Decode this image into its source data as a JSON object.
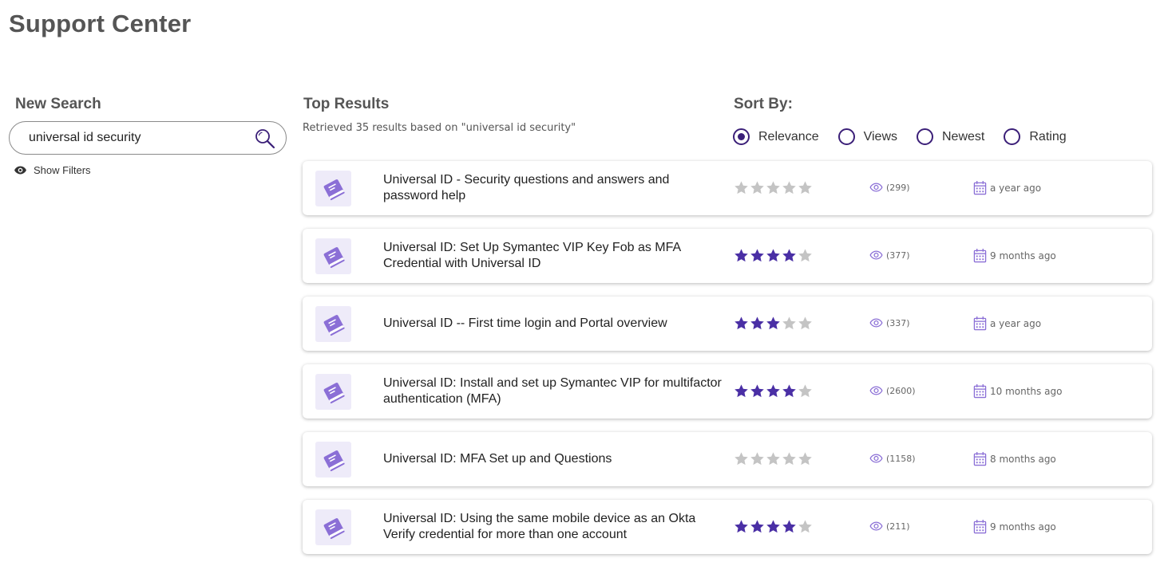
{
  "page": {
    "title": "Support Center"
  },
  "search": {
    "heading": "New Search",
    "value": "universal id security",
    "placeholder": "",
    "show_filters_label": "Show Filters"
  },
  "results": {
    "heading": "Top Results",
    "summary": "Retrieved 35 results based on \"universal id security\""
  },
  "sort": {
    "heading": "Sort By:",
    "options": [
      {
        "label": "Relevance",
        "selected": true
      },
      {
        "label": "Views",
        "selected": false
      },
      {
        "label": "Newest",
        "selected": false
      },
      {
        "label": "Rating",
        "selected": false
      }
    ]
  },
  "colors": {
    "accent": "#3b1f78",
    "star_filled": "#4a2fa5",
    "star_empty": "#c4c4c4",
    "icon_purple": "#8b6fd6",
    "tile_bg": "#eeebf9"
  },
  "items": [
    {
      "title": "Universal ID - Security questions and answers and password help",
      "rating": 0,
      "views": "(299)",
      "date": "a year ago",
      "icon": "book-icon"
    },
    {
      "title": "Universal ID: Set Up Symantec VIP Key Fob as MFA Credential with Universal ID",
      "rating": 4,
      "views": "(377)",
      "date": "9 months ago",
      "icon": "book-icon"
    },
    {
      "title": "Universal ID -- First time login and Portal overview",
      "rating": 3,
      "views": "(337)",
      "date": "a year ago",
      "icon": "book-icon"
    },
    {
      "title": "Universal ID: Install and set up Symantec VIP for multifactor authentication (MFA)",
      "rating": 4,
      "views": "(2600)",
      "date": "10 months ago",
      "icon": "book-icon"
    },
    {
      "title": "Universal ID: MFA Set up and Questions",
      "rating": 0,
      "views": "(1158)",
      "date": "8 months ago",
      "icon": "book-icon"
    },
    {
      "title": "Universal ID: Using the same mobile device as an Okta Verify credential for more than one account",
      "rating": 4,
      "views": "(211)",
      "date": "9 months ago",
      "icon": "book-icon"
    }
  ]
}
